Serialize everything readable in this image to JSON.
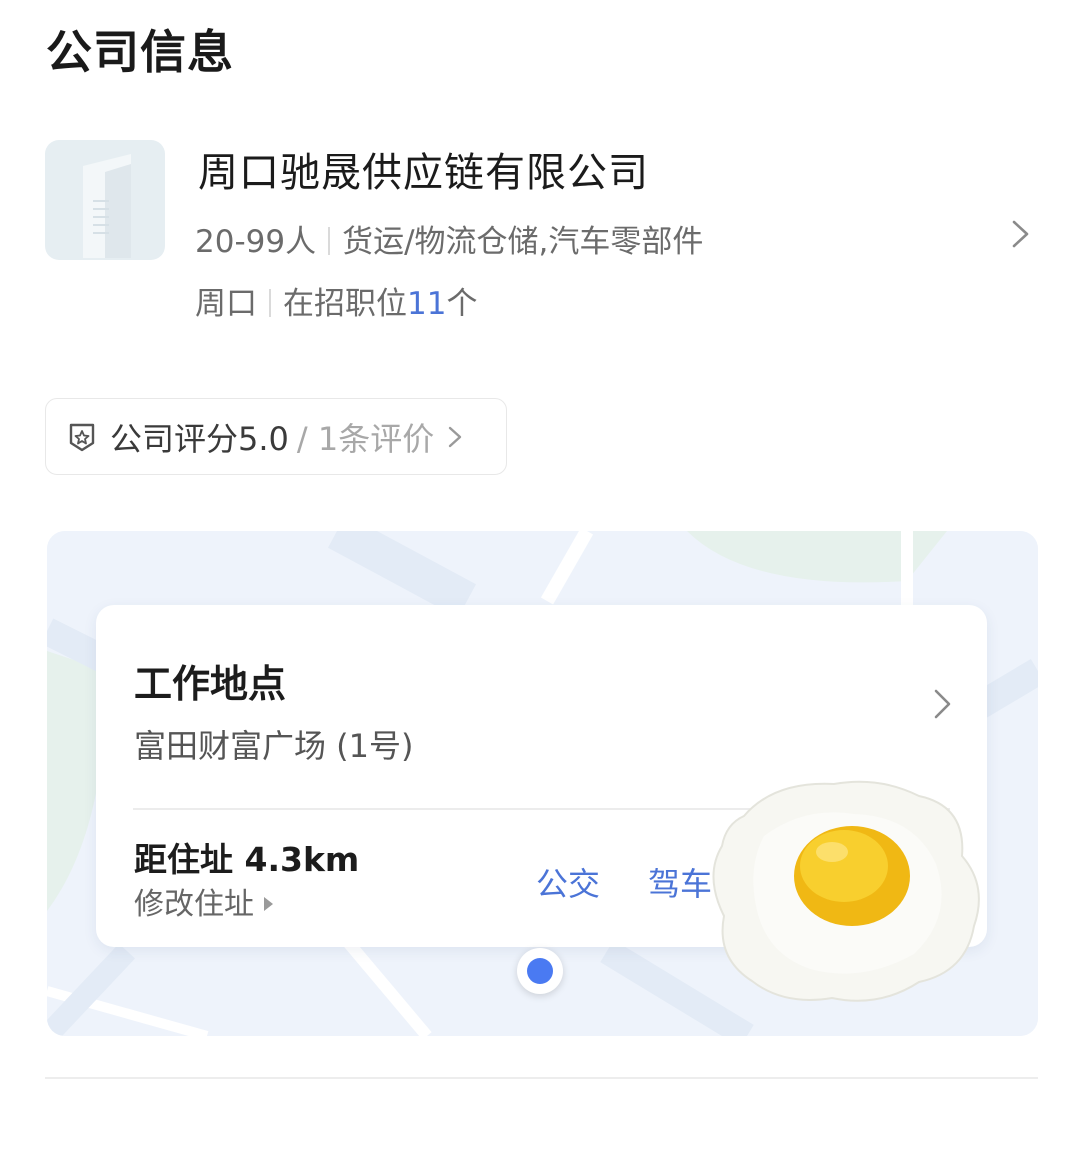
{
  "section": {
    "title": "公司信息"
  },
  "company": {
    "name": "周口驰晟供应链有限公司",
    "size": "20-99人",
    "industry": "货运/物流仓储,汽车零部件",
    "city": "周口",
    "jobs_prefix": "在招职位",
    "jobs_count": "11",
    "jobs_suffix": "个"
  },
  "rating": {
    "main": "公司评分5.0",
    "sub": "/ 1条评价"
  },
  "location": {
    "title": "工作地点",
    "address": "富田财富广场 (1号)",
    "distance": "距住址 4.3km",
    "edit_label": "修改住址",
    "bus_label": "公交",
    "drive_label": "驾车"
  },
  "icons": {
    "company_logo": "building-icon",
    "rating": "rating-badge-icon",
    "chevron": "chevron-right-icon",
    "pin": "location-pin-icon",
    "sticker": "fried-egg-sticker"
  },
  "colors": {
    "accent_blue": "#4b74d7",
    "pin_blue": "#4a7af2",
    "map_bg": "#eef3fb"
  }
}
